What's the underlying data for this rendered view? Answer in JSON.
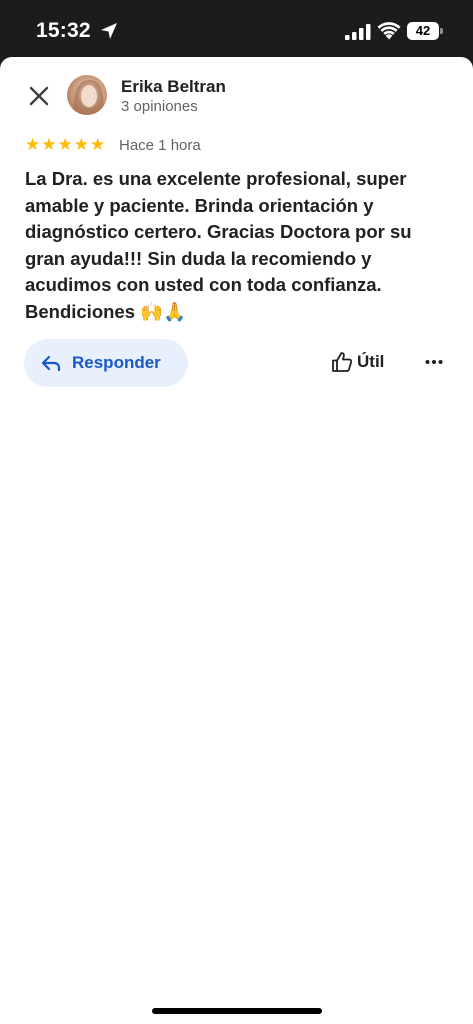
{
  "status_bar": {
    "time": "15:32",
    "battery": "42"
  },
  "review": {
    "author_name": "Erika Beltran",
    "author_reviews": "3 opiniones",
    "rating": 5,
    "stars": [
      "★",
      "★",
      "★",
      "★",
      "★"
    ],
    "time_ago": "Hace 1 hora",
    "text": "La Dra. es una excelente profesional, super amable y paciente. Brinda orientación y diagnóstico certero. Gracias Doctora por su gran ayuda!!! Sin duda la recomiendo y acudimos con usted con toda confianza. Bendiciones 🙌🙏"
  },
  "actions": {
    "reply_label": "Responder",
    "useful_label": "Útil"
  },
  "colors": {
    "star": "#fbbc04",
    "reply_bg": "#e8f0fe",
    "reply_text": "#1a57c7"
  },
  "icons": {
    "close": "close-icon",
    "location": "location-arrow-icon",
    "signal": "cellular-signal-icon",
    "wifi": "wifi-icon",
    "reply": "reply-arrow-icon",
    "useful": "thumbs-up-icon",
    "more": "more-horizontal-icon"
  }
}
